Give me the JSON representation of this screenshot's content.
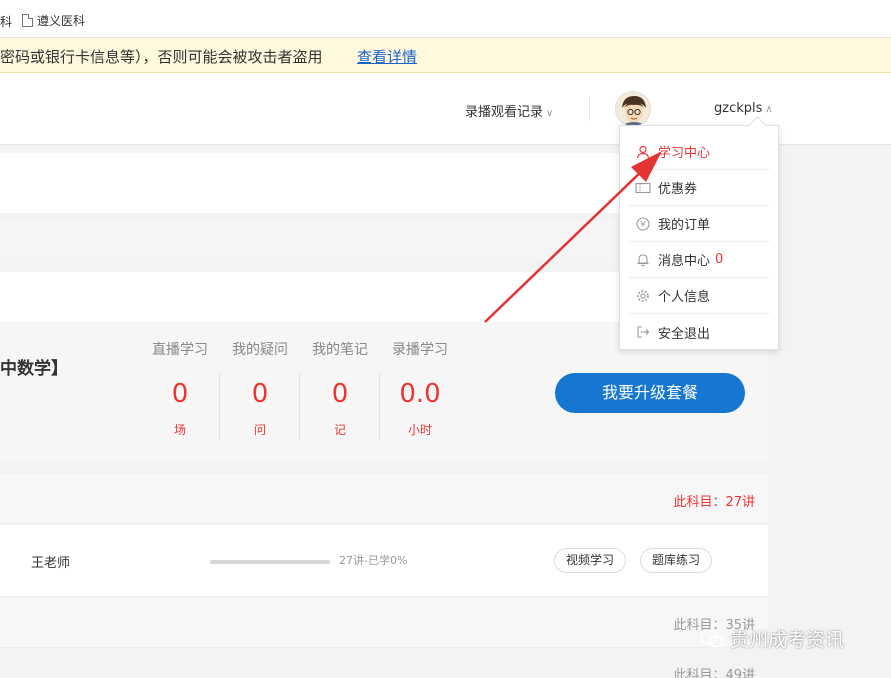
{
  "bookmarks": {
    "item0": "科",
    "item1": "遵义医科"
  },
  "warning": {
    "text": "密码或银行卡信息等），否则可能会被攻击者盗用",
    "link": "查看详情"
  },
  "header": {
    "record_menu": "录播观看记录",
    "username": "gzckpls"
  },
  "dropdown": {
    "items": [
      {
        "label": "学习中心",
        "icon": "user-icon"
      },
      {
        "label": "优惠券",
        "icon": "coupon-icon"
      },
      {
        "label": "我的订单",
        "icon": "order-icon"
      },
      {
        "label": "消息中心",
        "icon": "bell-icon",
        "badge": "0"
      },
      {
        "label": "个人信息",
        "icon": "gear-icon"
      },
      {
        "label": "安全退出",
        "icon": "logout-icon"
      }
    ]
  },
  "course": {
    "title": "中数学】",
    "stats": [
      {
        "label": "直播学习",
        "value": "0",
        "unit": "场"
      },
      {
        "label": "我的疑问",
        "value": "0",
        "unit": "问"
      },
      {
        "label": "我的笔记",
        "value": "0",
        "unit": "记"
      },
      {
        "label": "录播学习",
        "value": "0.0",
        "unit": "小时"
      }
    ],
    "upgrade_button": "我要升级套餐"
  },
  "subjects": [
    {
      "count": "此科目：27讲"
    },
    {
      "count": "此科目：35讲"
    },
    {
      "count": "此科目：49讲"
    }
  ],
  "row": {
    "teacher": "王老师",
    "progress_text": "27讲-已学0%",
    "progress": 0,
    "tags": [
      "视频学习",
      "题库练习"
    ]
  },
  "watermark": "贵州成考资讯",
  "colors": {
    "accent_blue": "#1677d2",
    "red": "#e33333",
    "arrow": "#e33333"
  }
}
